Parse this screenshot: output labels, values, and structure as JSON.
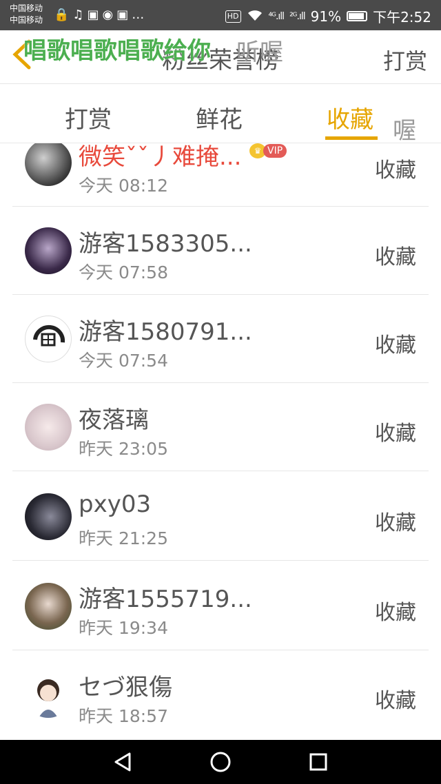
{
  "status_bar": {
    "carrier_1": "中国移动",
    "carrier_2": "中国移动",
    "left_icons": "🔒♫▣◉▣…",
    "hd": "HD",
    "signal_1": "⁴ᴳ.ıll",
    "signal_2": "²ᴳ.ıll",
    "battery": "91%",
    "time": "下午2:52"
  },
  "header": {
    "title": "粉丝荣誉榜",
    "action": "打赏",
    "back_icon": "chevron-left-icon",
    "overlay_green": "唱歌唱歌唱歌给你",
    "overlay_grey": "听喔"
  },
  "tabs": [
    {
      "label": "打赏",
      "active": false
    },
    {
      "label": "鲜花",
      "active": false
    },
    {
      "label": "收藏",
      "active": true
    }
  ],
  "tab_overlay": "喔",
  "list": [
    {
      "name": "微笑ˇˇ丿难掩...",
      "time": "今天 08:12",
      "action": "收藏",
      "vip": "VIP",
      "highlight": true
    },
    {
      "name": "游客1583305...",
      "time": "今天 07:58",
      "action": "收藏"
    },
    {
      "name": "游客1580791...",
      "time": "今天 07:54",
      "action": "收藏"
    },
    {
      "name": "夜落璃",
      "time": "昨天 23:05",
      "action": "收藏"
    },
    {
      "name": "pxy03",
      "time": "昨天 21:25",
      "action": "收藏"
    },
    {
      "name": "游客1555719...",
      "time": "昨天 19:34",
      "action": "收藏"
    },
    {
      "name": "セづ狠傷",
      "time": "昨天 18:57",
      "action": "收藏"
    }
  ],
  "colors": {
    "accent": "#e6a500",
    "highlight_name": "#e84a3c",
    "overlay_green": "#4caf50"
  }
}
